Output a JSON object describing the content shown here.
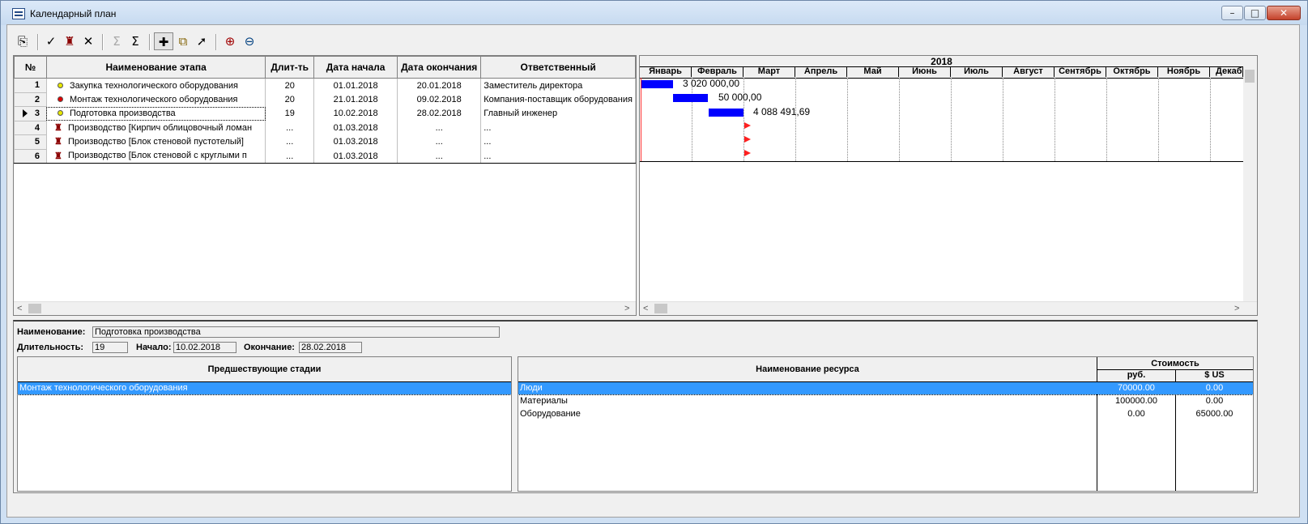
{
  "window": {
    "title": "Календарный план",
    "min": "–",
    "max": "□",
    "close": "✕"
  },
  "toolbar": [
    {
      "name": "properties-icon",
      "glyph": "⎘"
    },
    {
      "name": "check-icon",
      "glyph": "✓"
    },
    {
      "name": "factory-icon",
      "glyph": "♜"
    },
    {
      "name": "delete-icon",
      "glyph": "✕"
    },
    {
      "name": "sum-disabled-icon",
      "glyph": "Σ"
    },
    {
      "name": "sum-icon",
      "glyph": "Σ"
    },
    {
      "name": "add-stage-icon",
      "glyph": "✚"
    },
    {
      "name": "link-stages-icon",
      "glyph": "⧉"
    },
    {
      "name": "pointer-icon",
      "glyph": "➚"
    },
    {
      "name": "zoom-in-icon",
      "glyph": "⊕"
    },
    {
      "name": "zoom-out-icon",
      "glyph": "⊖"
    }
  ],
  "grid": {
    "headers": [
      "№",
      "Наименование этапа",
      "Длит-ть",
      "Дата начала",
      "Дата окончания",
      "Ответственный"
    ],
    "rows": [
      {
        "num": "1",
        "name": "Закупка технологического оборудования",
        "duration": "20",
        "start": "01.01.2018",
        "end": "20.01.2018",
        "resp": "Заместитель директора",
        "icon": "yellow-dot-icon",
        "icon_color": "#e8e800"
      },
      {
        "num": "2",
        "name": "Монтаж технологического оборудования",
        "duration": "20",
        "start": "21.01.2018",
        "end": "09.02.2018",
        "resp": "Компания-поставщик оборудования",
        "icon": "red-dot-icon",
        "icon_color": "#e00000"
      },
      {
        "num": "3",
        "name": "Подготовка производства",
        "duration": "19",
        "start": "10.02.2018",
        "end": "28.02.2018",
        "resp": "Главный инженер",
        "icon": "yellow-dot-icon",
        "icon_color": "#e8e800"
      },
      {
        "num": "4",
        "name": "Производство [Кирпич облицовочный ломан",
        "duration": "...",
        "start": "01.03.2018",
        "end": "...",
        "resp": "...",
        "icon": "factory-icon",
        "icon_color": "#8b0000"
      },
      {
        "num": "5",
        "name": "Производство [Блок стеновой пустотелый]",
        "duration": "...",
        "start": "01.03.2018",
        "end": "...",
        "resp": "...",
        "icon": "factory-icon",
        "icon_color": "#8b0000"
      },
      {
        "num": "6",
        "name": "Производство [Блок стеновой  с круглыми п",
        "duration": "...",
        "start": "01.03.2018",
        "end": "...",
        "resp": "...",
        "icon": "factory-icon",
        "icon_color": "#8b0000"
      }
    ]
  },
  "gantt": {
    "year": "2018",
    "months": [
      "Январь",
      "Февраль",
      "Март",
      "Апрель",
      "Май",
      "Июнь",
      "Июль",
      "Август",
      "Сентябрь",
      "Октябрь",
      "Ноябрь",
      "Декабрь"
    ],
    "bar_color": "#0000ff",
    "labels": [
      "3 020 000,00",
      "50 000,00",
      "4 088 491,69"
    ]
  },
  "details": {
    "name_label": "Наименование:",
    "name_value": "Подготовка производства",
    "duration_label": "Длительность:",
    "duration_value": "19",
    "start_label": "Начало:",
    "start_value": "10.02.2018",
    "end_label": "Окончание:",
    "end_value": "28.02.2018",
    "pred_header": "Предшествующие стадии",
    "predecessors": [
      "Монтаж технологического оборудования"
    ],
    "res_header": "Наименование ресурса",
    "cost_header": "Стоимость",
    "rub_header": "руб.",
    "usd_header": "$ US",
    "resources": [
      {
        "name": "Люди",
        "rub": "70000.00",
        "usd": "0.00"
      },
      {
        "name": "Материалы",
        "rub": "100000.00",
        "usd": "0.00"
      },
      {
        "name": "Оборудование",
        "rub": "0.00",
        "usd": "65000.00"
      }
    ]
  }
}
